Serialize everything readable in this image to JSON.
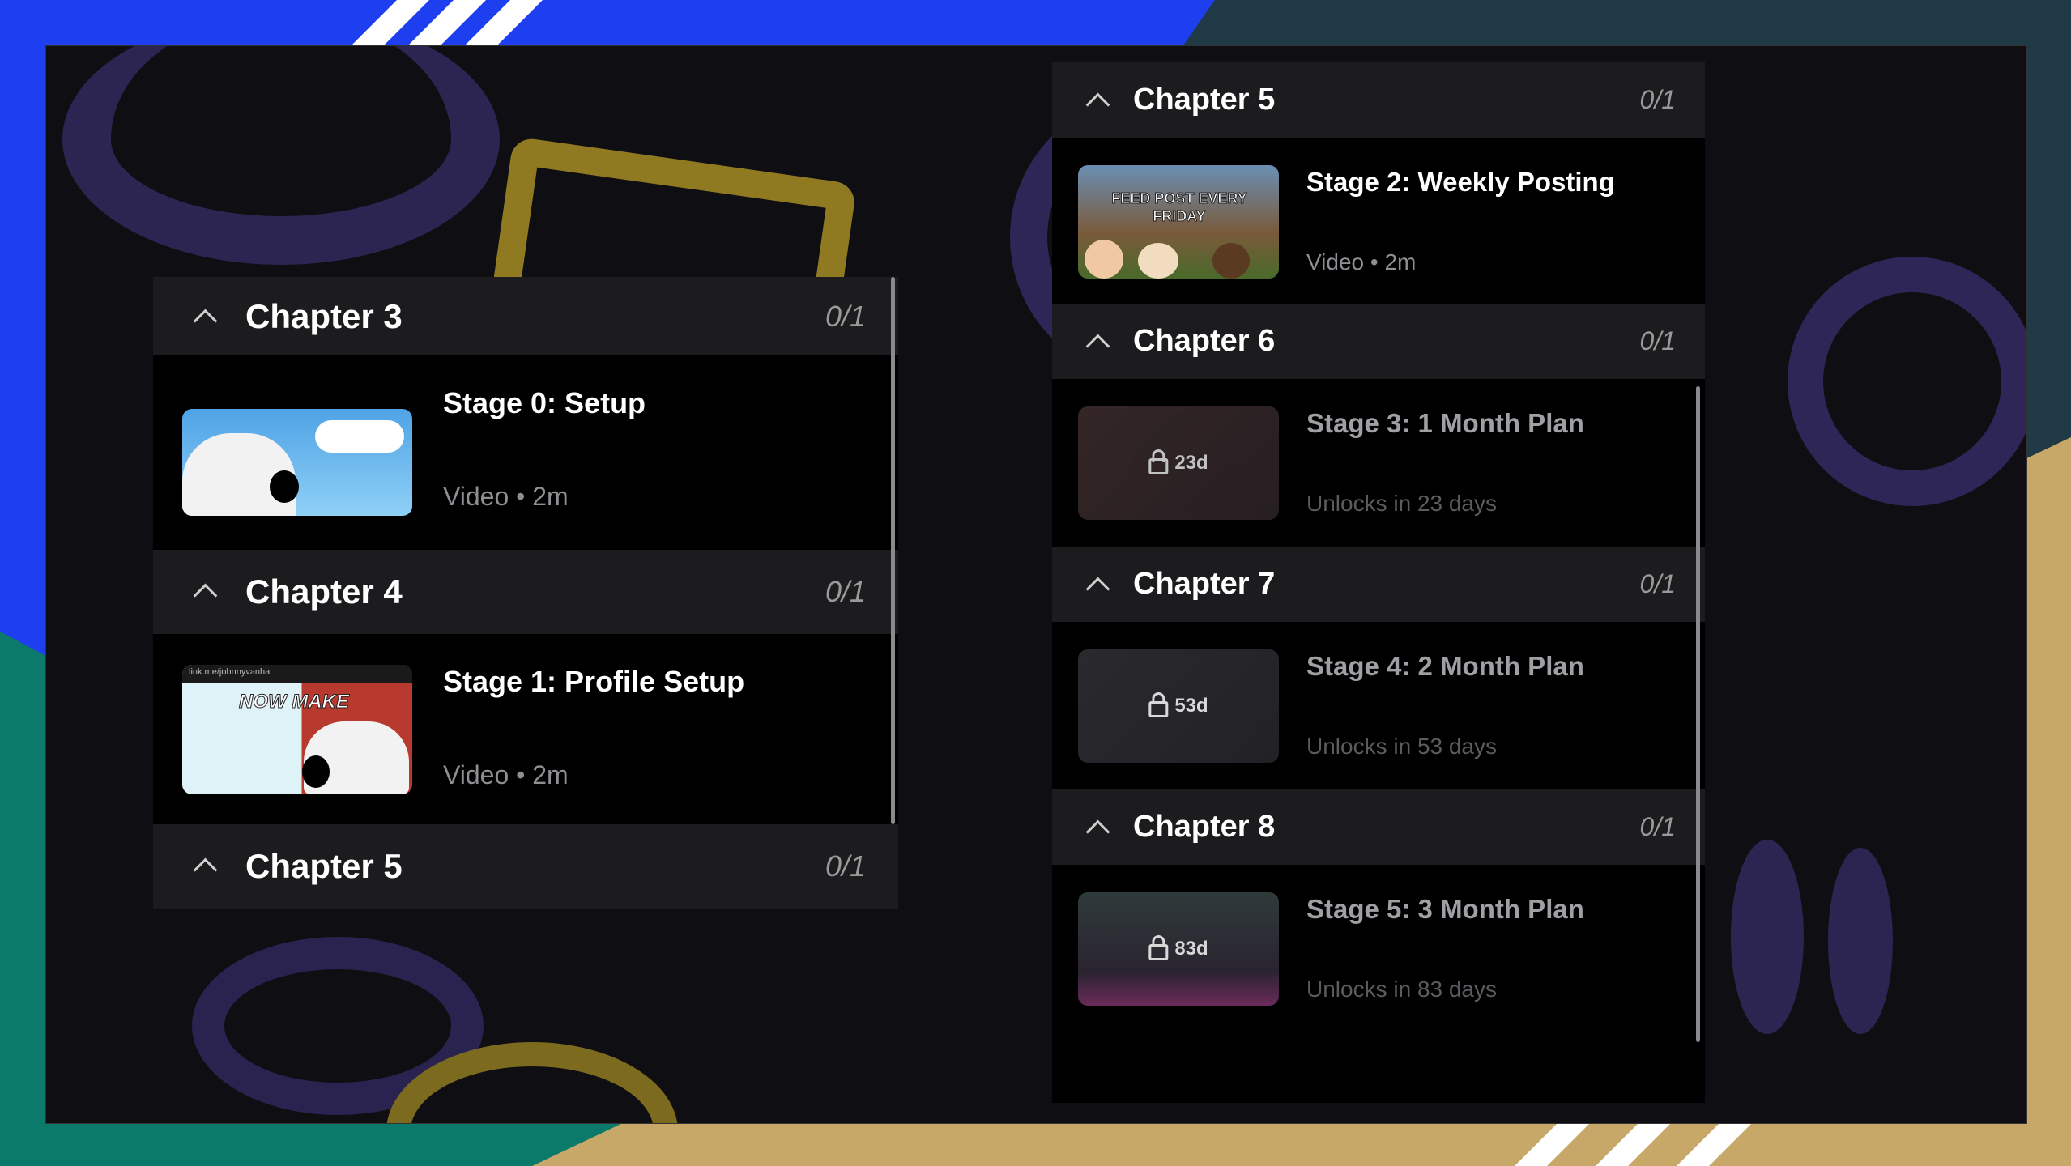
{
  "left_panel": {
    "chapters": [
      {
        "title": "Chapter 3",
        "progress": "0/1",
        "lesson": {
          "title": "Stage 0: Setup",
          "meta": "Video • 2m"
        }
      },
      {
        "title": "Chapter 4",
        "progress": "0/1",
        "lesson": {
          "title": "Stage 1: Profile Setup",
          "meta": "Video • 2m",
          "thumb_caption": "NOW MAKE",
          "thumb_handle": "link.me/johnnyvanhal"
        }
      },
      {
        "title": "Chapter 5",
        "progress": "0/1"
      }
    ]
  },
  "right_panel": {
    "chapters": [
      {
        "title": "Chapter 5",
        "progress": "0/1",
        "lesson": {
          "title": "Stage 2: Weekly Posting",
          "meta": "Video • 2m",
          "thumb_caption": "FEED POST EVERY FRIDAY"
        }
      },
      {
        "title": "Chapter 6",
        "progress": "0/1",
        "lesson": {
          "title": "Stage 3: 1 Month Plan",
          "meta": "Unlocks in 23 days",
          "lock": "23d"
        }
      },
      {
        "title": "Chapter 7",
        "progress": "0/1",
        "lesson": {
          "title": "Stage 4: 2 Month Plan",
          "meta": "Unlocks in 53 days",
          "lock": "53d"
        }
      },
      {
        "title": "Chapter 8",
        "progress": "0/1",
        "lesson": {
          "title": "Stage 5: 3 Month Plan",
          "meta": "Unlocks in 83 days",
          "lock": "83d"
        }
      }
    ]
  },
  "icons": {
    "chevron": "chevron-up-icon",
    "lock": "lock-icon"
  },
  "colors": {
    "panel_bg": "#000000",
    "header_bg": "#1c1c1e",
    "muted_text": "#8e8e93",
    "doodle_purple": "#3b2f6b",
    "doodle_yellow": "#b59a2a"
  }
}
